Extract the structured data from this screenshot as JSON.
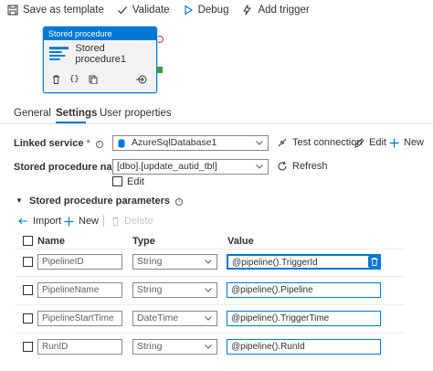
{
  "toolbar": {
    "save_template": "Save as template",
    "validate": "Validate",
    "debug": "Debug",
    "add_trigger": "Add trigger"
  },
  "activity": {
    "type_label": "Stored procedure",
    "name": "Stored procedure1"
  },
  "tabs": {
    "general": "General",
    "settings": "Settings",
    "user_properties": "User properties"
  },
  "linked_service": {
    "label": "Linked service",
    "required_mark": "*",
    "value": "AzureSqlDatabase1",
    "test_connection": "Test connection",
    "edit": "Edit",
    "new": "New"
  },
  "stored_procedure": {
    "label": "Stored procedure name",
    "required_mark": "*",
    "value": "[dbo].[update_autid_tbl]",
    "refresh": "Refresh",
    "edit_checkbox_label": "Edit"
  },
  "params": {
    "title": "Stored procedure parameters",
    "import": "Import",
    "new": "New",
    "delete": "Delete",
    "headers": {
      "name": "Name",
      "type": "Type",
      "value": "Value"
    },
    "rows": [
      {
        "name": "PipelineID",
        "type": "String",
        "value": "@pipeline().TriggerId"
      },
      {
        "name": "PipelineName",
        "type": "String",
        "value": "@pipeline().Pipeline"
      },
      {
        "name": "PipelineStartTime",
        "type": "DateTime",
        "value": "@pipeline().TriggerTime"
      },
      {
        "name": "RunID",
        "type": "String",
        "value": "@pipeline().RunId"
      }
    ]
  },
  "colors": {
    "accent": "#0078d4",
    "success": "#3e9a3a",
    "error": "#d13438"
  }
}
